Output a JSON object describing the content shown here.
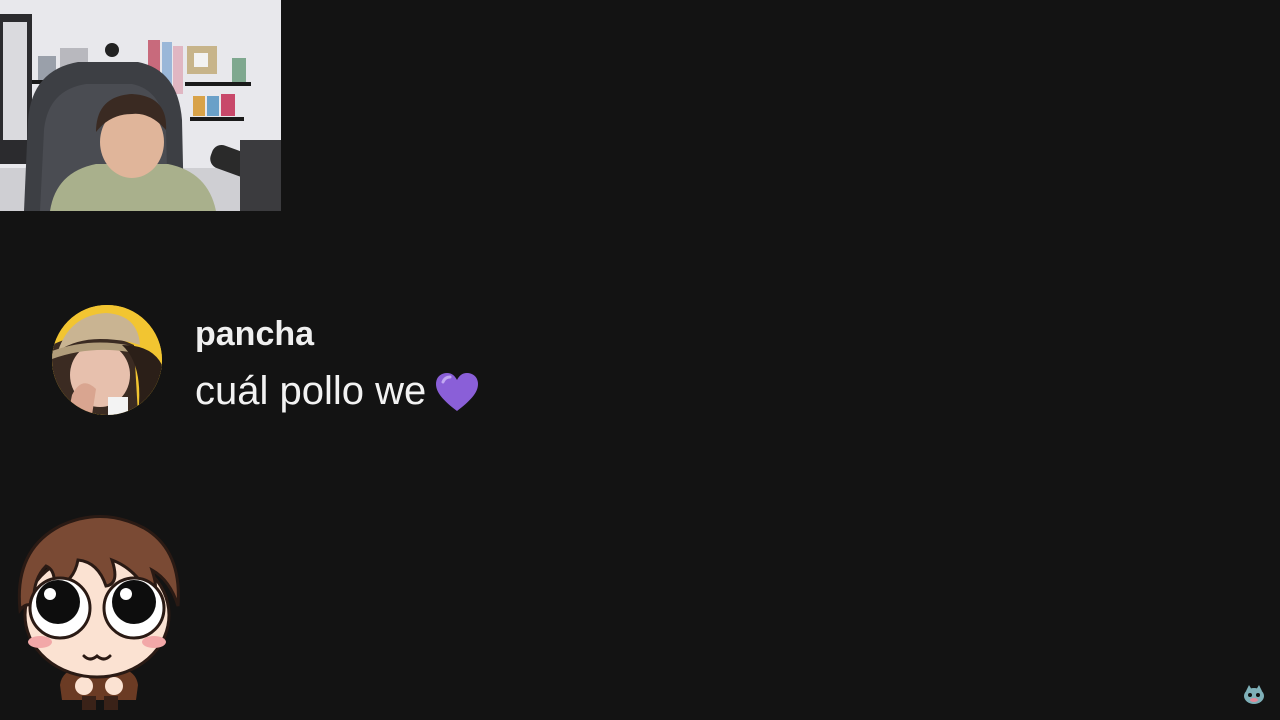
{
  "webcam": {
    "icon": "streamer-webcam-feed"
  },
  "chat_comment": {
    "username": "pancha",
    "message": "cuál pollo we",
    "emoji": "purple-heart-icon",
    "avatar_icon": "user-avatar"
  },
  "overlay": {
    "mascot_icon": "chibi-mascot-icon",
    "corner_logo_icon": "channel-logo-icon"
  },
  "colors": {
    "background": "#131313",
    "text": "#f2f2f2",
    "heart": "#8a5fd8",
    "avatar_bg": "#f2c531"
  }
}
